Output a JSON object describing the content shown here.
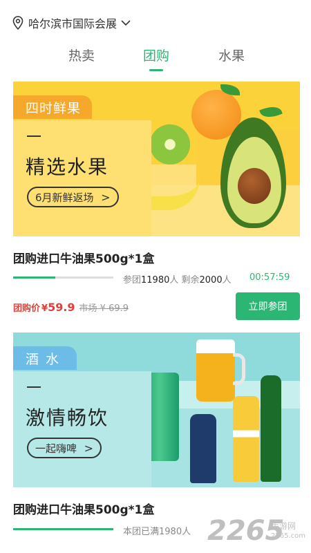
{
  "header": {
    "location": "哈尔滨市国际会展",
    "location_icon": "location-pin-icon",
    "dropdown_icon": "chevron-down-icon"
  },
  "tabs": [
    {
      "label": "热卖",
      "active": false
    },
    {
      "label": "团购",
      "active": true
    },
    {
      "label": "水果",
      "active": false
    }
  ],
  "colors": {
    "accent": "#2bb673",
    "price": "#e0403a"
  },
  "products": [
    {
      "banner": {
        "tag": "四时鲜果",
        "dash": "—",
        "headline": "精选水果",
        "pill": "6月新鲜返场",
        "pill_icon": "chevron-right-icon"
      },
      "title": "团购进口牛油果500g*1盒",
      "progress": 0.42,
      "stats_prefix": "参团",
      "stats_count": "11980",
      "stats_suffix": "人  剩余",
      "stats_remain": "2000",
      "stats_end": "人",
      "timer": "00:57:59",
      "price_label": "团购价",
      "price_symbol": "¥",
      "price": "59.9",
      "market_price": "市场 ¥ 69.9",
      "button": "立即参团"
    },
    {
      "banner": {
        "tag": "酒水",
        "dash": "—",
        "headline": "激情畅饮",
        "pill": "一起嗨啤",
        "pill_icon": "chevron-right-icon"
      },
      "title": "团购进口牛油果500g*1盒",
      "progress": 1.0,
      "stats_text": "本团已满1980人"
    }
  ],
  "watermark": {
    "logo": "2265",
    "sub": "手游网",
    "url": "2265.com"
  }
}
